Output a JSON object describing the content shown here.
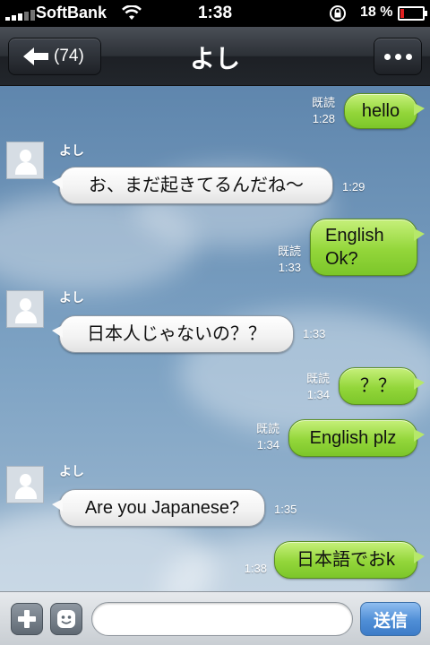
{
  "status_bar": {
    "carrier": "SoftBank",
    "time": "1:38",
    "battery_percent": "18 %",
    "battery_level": 0.18,
    "battery_color": "#e02020"
  },
  "nav": {
    "back_label": "(74)",
    "title": "よし",
    "back_icon": "left-arrow-icon",
    "menu_icon": "more-dots-icon"
  },
  "contact": {
    "name": "よし",
    "avatar_icon": "default-person-icon"
  },
  "messages": [
    {
      "direction": "out",
      "text": "hello",
      "read": "既読",
      "time": "1:28"
    },
    {
      "direction": "in",
      "sender": "よし",
      "text": "お、まだ起きてるんだね〜",
      "time": "1:29"
    },
    {
      "direction": "out",
      "text_lines": [
        "English",
        "Ok?"
      ],
      "read": "既読",
      "time": "1:33"
    },
    {
      "direction": "in",
      "sender": "よし",
      "text": "日本人じゃないの？？",
      "time": "1:33"
    },
    {
      "direction": "out",
      "text": "？？",
      "read": "既読",
      "time": "1:34"
    },
    {
      "direction": "out",
      "text": "English plz",
      "read": "既読",
      "time": "1:34"
    },
    {
      "direction": "in",
      "sender": "よし",
      "text": "Are you Japanese?",
      "time": "1:35"
    },
    {
      "direction": "out",
      "text": "日本語でおk",
      "time": "1:38"
    }
  ],
  "input_bar": {
    "placeholder": "",
    "value": "",
    "send_label": "送信",
    "plus_icon": "plus-icon",
    "emoji_icon": "smiley-icon"
  },
  "colors": {
    "outgoing_bubble": "#93d63a",
    "incoming_bubble": "#f2f2f2",
    "send_button": "#4f8ed6"
  }
}
